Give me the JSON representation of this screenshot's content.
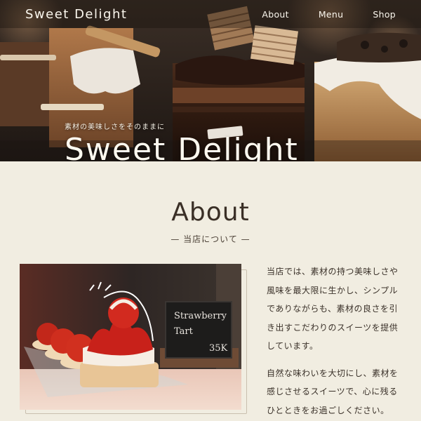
{
  "header": {
    "logo": "Sweet Delight",
    "nav": [
      "About",
      "Menu",
      "Shop"
    ]
  },
  "hero": {
    "tagline": "素材の美味しさをそのままに",
    "title": "Sweet Delight"
  },
  "about": {
    "heading": "About",
    "subheading": "— 当店について —",
    "paragraphs": [
      "当店では、素材の持つ美味しさや風味を最大限に生かし、シンプルでありながらも、素材の良さを引き出すこだわりのスイーツを提供しています。",
      "自然な味わいを大切にし、素材を感じさせるスイーツで、心に残るひとときをお過ごしください。"
    ],
    "photo_sign": [
      "Strawberry",
      "Tart",
      "35K"
    ]
  },
  "colors": {
    "background": "#f1ede1",
    "text": "#3a332c",
    "hero_text": "#fffaf0"
  }
}
